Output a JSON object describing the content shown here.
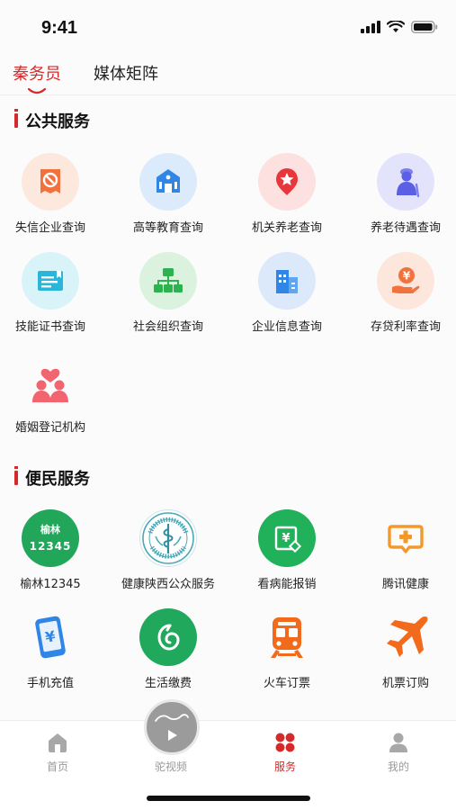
{
  "status_bar": {
    "time": "9:41"
  },
  "top_tabs": [
    {
      "label": "秦务员",
      "active": true
    },
    {
      "label": "媒体矩阵",
      "active": false
    }
  ],
  "public_services": {
    "title": "公共服务",
    "items": [
      {
        "label": "失信企业查询",
        "icon": "credit-ban-icon"
      },
      {
        "label": "高等教育查询",
        "icon": "university-icon"
      },
      {
        "label": "机关养老查询",
        "icon": "star-badge-icon"
      },
      {
        "label": "养老待遇查询",
        "icon": "elderly-person-icon"
      },
      {
        "label": "技能证书查询",
        "icon": "certificate-icon"
      },
      {
        "label": "社会组织查询",
        "icon": "org-chart-icon"
      },
      {
        "label": "企业信息查询",
        "icon": "building-icon"
      },
      {
        "label": "存贷利率查询",
        "icon": "yuan-hand-icon"
      },
      {
        "label": "婚姻登记机构",
        "icon": "couple-heart-icon"
      }
    ]
  },
  "convenience_services": {
    "title": "便民服务",
    "items": [
      {
        "label": "榆林12345",
        "icon": "yulin-12345-icon",
        "badge_line1": "榆林",
        "badge_line2": "12345"
      },
      {
        "label": "健康陕西公众服务",
        "icon": "health-shaanxi-emblem-icon"
      },
      {
        "label": "看病能报销",
        "icon": "medical-reimburse-icon"
      },
      {
        "label": "腾讯健康",
        "icon": "tencent-health-icon"
      },
      {
        "label": "手机充值",
        "icon": "phone-recharge-icon"
      },
      {
        "label": "生活缴费",
        "icon": "utility-payment-icon"
      },
      {
        "label": "火车订票",
        "icon": "train-icon"
      },
      {
        "label": "机票订购",
        "icon": "airplane-icon"
      }
    ]
  },
  "tabbar": {
    "items": [
      {
        "label": "首页",
        "icon": "home-icon",
        "active": false
      },
      {
        "label": "驼视频",
        "icon": "video-play-icon",
        "active": false
      },
      {
        "label": "服务",
        "icon": "services-grid-icon",
        "active": true
      },
      {
        "label": "我的",
        "icon": "user-icon",
        "active": false
      }
    ]
  },
  "colors": {
    "accent": "#d62a2a",
    "inactive_tab": "#9a9a9a"
  }
}
